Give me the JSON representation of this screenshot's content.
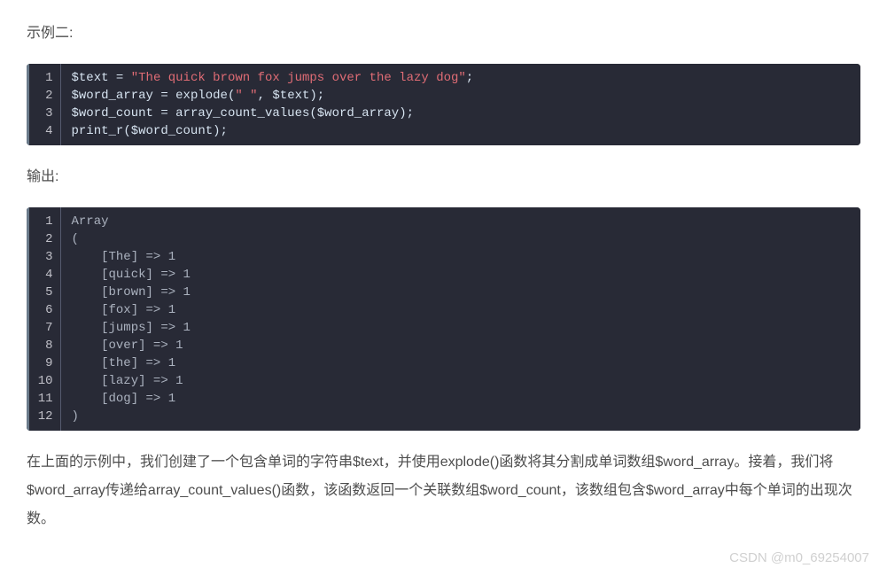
{
  "para1": "示例二:",
  "para2": "输出:",
  "para3": "在上面的示例中，我们创建了一个包含单词的字符串$text，并使用explode()函数将其分割成单词数组$word_array。接着，我们将$word_array传递给array_count_values()函数，该函数返回一个关联数组$word_count，该数组包含$word_array中每个单词的出现次数。",
  "watermark": "CSDN @m0_69254007",
  "code1": {
    "lines": [
      {
        "n": "1",
        "segs": [
          {
            "t": "$text",
            "c": "tok-var"
          },
          {
            "t": " = ",
            "c": "tok-op"
          },
          {
            "t": "\"The quick brown fox jumps over the lazy dog\"",
            "c": "tok-str"
          },
          {
            "t": ";",
            "c": "tok-pn"
          }
        ]
      },
      {
        "n": "2",
        "segs": [
          {
            "t": "$word_array",
            "c": "tok-var"
          },
          {
            "t": " = ",
            "c": "tok-op"
          },
          {
            "t": "explode",
            "c": "tok-fn"
          },
          {
            "t": "(",
            "c": "tok-pn"
          },
          {
            "t": "\" \"",
            "c": "tok-str"
          },
          {
            "t": ", ",
            "c": "tok-pn"
          },
          {
            "t": "$text",
            "c": "tok-var"
          },
          {
            "t": ");",
            "c": "tok-pn"
          }
        ]
      },
      {
        "n": "3",
        "segs": [
          {
            "t": "$word_count",
            "c": "tok-var"
          },
          {
            "t": " = ",
            "c": "tok-op"
          },
          {
            "t": "array_count_values",
            "c": "tok-fn"
          },
          {
            "t": "(",
            "c": "tok-pn"
          },
          {
            "t": "$word_array",
            "c": "tok-var"
          },
          {
            "t": ");",
            "c": "tok-pn"
          }
        ]
      },
      {
        "n": "4",
        "segs": [
          {
            "t": "print_r",
            "c": "tok-fn"
          },
          {
            "t": "(",
            "c": "tok-pn"
          },
          {
            "t": "$word_count",
            "c": "tok-var"
          },
          {
            "t": ");",
            "c": "tok-pn"
          }
        ]
      }
    ]
  },
  "code2": {
    "lines": [
      {
        "n": "1",
        "segs": [
          {
            "t": "Array",
            "c": "tok-pl"
          }
        ]
      },
      {
        "n": "2",
        "segs": [
          {
            "t": "(",
            "c": "tok-pl"
          }
        ]
      },
      {
        "n": "3",
        "segs": [
          {
            "t": "    [The] => 1",
            "c": "tok-pl"
          }
        ]
      },
      {
        "n": "4",
        "segs": [
          {
            "t": "    [quick] => 1",
            "c": "tok-pl"
          }
        ]
      },
      {
        "n": "5",
        "segs": [
          {
            "t": "    [brown] => 1",
            "c": "tok-pl"
          }
        ]
      },
      {
        "n": "6",
        "segs": [
          {
            "t": "    [fox] => 1",
            "c": "tok-pl"
          }
        ]
      },
      {
        "n": "7",
        "segs": [
          {
            "t": "    [jumps] => 1",
            "c": "tok-pl"
          }
        ]
      },
      {
        "n": "8",
        "segs": [
          {
            "t": "    [over] => 1",
            "c": "tok-pl"
          }
        ]
      },
      {
        "n": "9",
        "segs": [
          {
            "t": "    [the] => 1",
            "c": "tok-pl"
          }
        ]
      },
      {
        "n": "10",
        "segs": [
          {
            "t": "    [lazy] => 1",
            "c": "tok-pl"
          }
        ]
      },
      {
        "n": "11",
        "segs": [
          {
            "t": "    [dog] => 1",
            "c": "tok-pl"
          }
        ]
      },
      {
        "n": "12",
        "segs": [
          {
            "t": ")",
            "c": "tok-pl"
          }
        ]
      }
    ]
  }
}
